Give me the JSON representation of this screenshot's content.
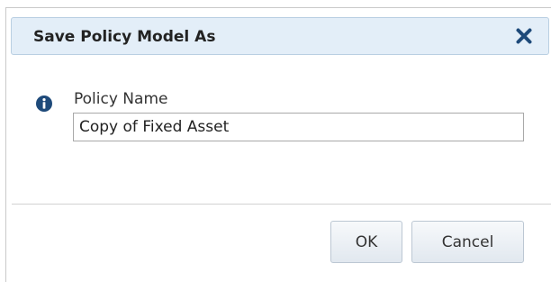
{
  "dialog": {
    "title": "Save Policy Model As",
    "close_icon": "close-x-icon"
  },
  "form": {
    "info_icon": "info-circle-icon",
    "policy_name_label": "Policy Name",
    "policy_name_value": "Copy of Fixed Asset"
  },
  "actions": {
    "ok_label": "OK",
    "cancel_label": "Cancel"
  },
  "colors": {
    "titlebar_bg": "#e3eef8",
    "icon_color": "#1e4a7a",
    "button_border": "#bcc7d3"
  }
}
